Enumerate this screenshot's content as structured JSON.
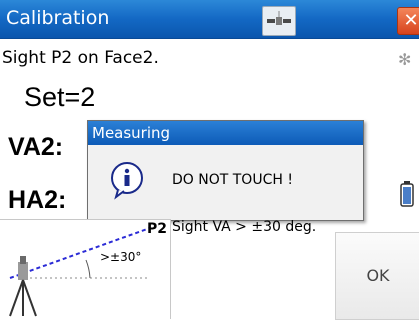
{
  "window": {
    "title": "Calibration",
    "close_glyph": "✕"
  },
  "instruction": "Sight P2 on Face2.",
  "readings": {
    "set": "Set=2",
    "va2_label": "VA2:",
    "ha2_label": "HA2:"
  },
  "dialog": {
    "title": "Measuring",
    "message": "DO NOT TOUCH !",
    "icon": "info-icon"
  },
  "diagram": {
    "point_label": "P2",
    "angle_label": ">±30°"
  },
  "hint": "Sight VA > ±30 deg.",
  "ok_button": "OK",
  "icons": {
    "status": "satellite-icon",
    "settings": "gear-icon",
    "battery": "battery-icon"
  },
  "colors": {
    "titlebar": "#1368c4",
    "dialog_title": "#0d5bb7",
    "close": "#d7431d",
    "sight_line": "#2b2bd6"
  }
}
